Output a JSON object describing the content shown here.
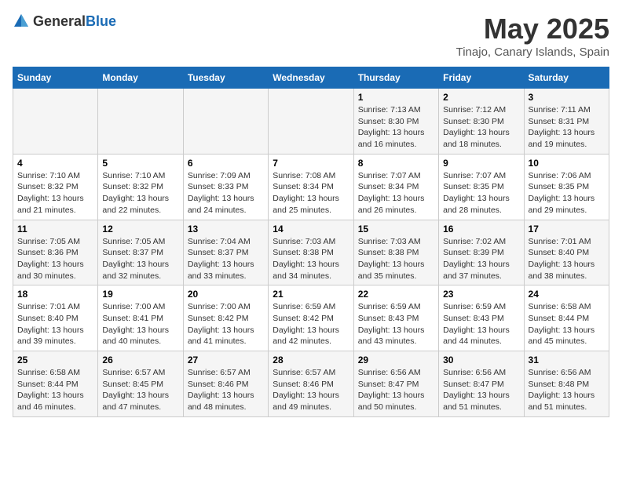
{
  "header": {
    "logo_general": "General",
    "logo_blue": "Blue",
    "title": "May 2025",
    "subtitle": "Tinajo, Canary Islands, Spain"
  },
  "days_of_week": [
    "Sunday",
    "Monday",
    "Tuesday",
    "Wednesday",
    "Thursday",
    "Friday",
    "Saturday"
  ],
  "weeks": [
    [
      {
        "day": "",
        "info": ""
      },
      {
        "day": "",
        "info": ""
      },
      {
        "day": "",
        "info": ""
      },
      {
        "day": "",
        "info": ""
      },
      {
        "day": "1",
        "info": "Sunrise: 7:13 AM\nSunset: 8:30 PM\nDaylight: 13 hours and 16 minutes."
      },
      {
        "day": "2",
        "info": "Sunrise: 7:12 AM\nSunset: 8:30 PM\nDaylight: 13 hours and 18 minutes."
      },
      {
        "day": "3",
        "info": "Sunrise: 7:11 AM\nSunset: 8:31 PM\nDaylight: 13 hours and 19 minutes."
      }
    ],
    [
      {
        "day": "4",
        "info": "Sunrise: 7:10 AM\nSunset: 8:32 PM\nDaylight: 13 hours and 21 minutes."
      },
      {
        "day": "5",
        "info": "Sunrise: 7:10 AM\nSunset: 8:32 PM\nDaylight: 13 hours and 22 minutes."
      },
      {
        "day": "6",
        "info": "Sunrise: 7:09 AM\nSunset: 8:33 PM\nDaylight: 13 hours and 24 minutes."
      },
      {
        "day": "7",
        "info": "Sunrise: 7:08 AM\nSunset: 8:34 PM\nDaylight: 13 hours and 25 minutes."
      },
      {
        "day": "8",
        "info": "Sunrise: 7:07 AM\nSunset: 8:34 PM\nDaylight: 13 hours and 26 minutes."
      },
      {
        "day": "9",
        "info": "Sunrise: 7:07 AM\nSunset: 8:35 PM\nDaylight: 13 hours and 28 minutes."
      },
      {
        "day": "10",
        "info": "Sunrise: 7:06 AM\nSunset: 8:35 PM\nDaylight: 13 hours and 29 minutes."
      }
    ],
    [
      {
        "day": "11",
        "info": "Sunrise: 7:05 AM\nSunset: 8:36 PM\nDaylight: 13 hours and 30 minutes."
      },
      {
        "day": "12",
        "info": "Sunrise: 7:05 AM\nSunset: 8:37 PM\nDaylight: 13 hours and 32 minutes."
      },
      {
        "day": "13",
        "info": "Sunrise: 7:04 AM\nSunset: 8:37 PM\nDaylight: 13 hours and 33 minutes."
      },
      {
        "day": "14",
        "info": "Sunrise: 7:03 AM\nSunset: 8:38 PM\nDaylight: 13 hours and 34 minutes."
      },
      {
        "day": "15",
        "info": "Sunrise: 7:03 AM\nSunset: 8:38 PM\nDaylight: 13 hours and 35 minutes."
      },
      {
        "day": "16",
        "info": "Sunrise: 7:02 AM\nSunset: 8:39 PM\nDaylight: 13 hours and 37 minutes."
      },
      {
        "day": "17",
        "info": "Sunrise: 7:01 AM\nSunset: 8:40 PM\nDaylight: 13 hours and 38 minutes."
      }
    ],
    [
      {
        "day": "18",
        "info": "Sunrise: 7:01 AM\nSunset: 8:40 PM\nDaylight: 13 hours and 39 minutes."
      },
      {
        "day": "19",
        "info": "Sunrise: 7:00 AM\nSunset: 8:41 PM\nDaylight: 13 hours and 40 minutes."
      },
      {
        "day": "20",
        "info": "Sunrise: 7:00 AM\nSunset: 8:42 PM\nDaylight: 13 hours and 41 minutes."
      },
      {
        "day": "21",
        "info": "Sunrise: 6:59 AM\nSunset: 8:42 PM\nDaylight: 13 hours and 42 minutes."
      },
      {
        "day": "22",
        "info": "Sunrise: 6:59 AM\nSunset: 8:43 PM\nDaylight: 13 hours and 43 minutes."
      },
      {
        "day": "23",
        "info": "Sunrise: 6:59 AM\nSunset: 8:43 PM\nDaylight: 13 hours and 44 minutes."
      },
      {
        "day": "24",
        "info": "Sunrise: 6:58 AM\nSunset: 8:44 PM\nDaylight: 13 hours and 45 minutes."
      }
    ],
    [
      {
        "day": "25",
        "info": "Sunrise: 6:58 AM\nSunset: 8:44 PM\nDaylight: 13 hours and 46 minutes."
      },
      {
        "day": "26",
        "info": "Sunrise: 6:57 AM\nSunset: 8:45 PM\nDaylight: 13 hours and 47 minutes."
      },
      {
        "day": "27",
        "info": "Sunrise: 6:57 AM\nSunset: 8:46 PM\nDaylight: 13 hours and 48 minutes."
      },
      {
        "day": "28",
        "info": "Sunrise: 6:57 AM\nSunset: 8:46 PM\nDaylight: 13 hours and 49 minutes."
      },
      {
        "day": "29",
        "info": "Sunrise: 6:56 AM\nSunset: 8:47 PM\nDaylight: 13 hours and 50 minutes."
      },
      {
        "day": "30",
        "info": "Sunrise: 6:56 AM\nSunset: 8:47 PM\nDaylight: 13 hours and 51 minutes."
      },
      {
        "day": "31",
        "info": "Sunrise: 6:56 AM\nSunset: 8:48 PM\nDaylight: 13 hours and 51 minutes."
      }
    ]
  ]
}
